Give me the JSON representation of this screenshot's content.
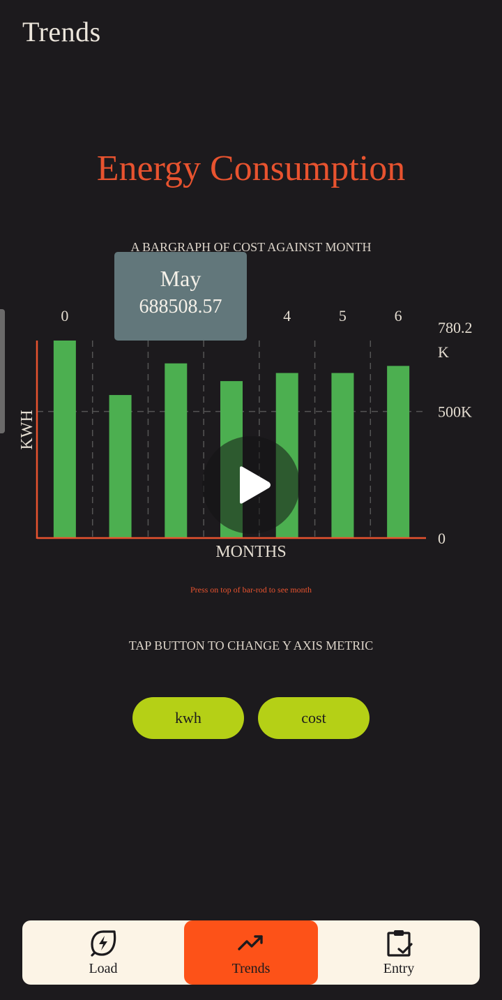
{
  "app": {
    "title": "Trends"
  },
  "chart": {
    "title": "Energy Consumption",
    "subtitle": "A BARGRAPH OF COST AGAINST MONTH",
    "hint": "Press on top of bar-rod to see month",
    "tooltip": {
      "month": "May",
      "value": "688508.57"
    }
  },
  "chart_data": {
    "type": "bar",
    "categories": [
      "0",
      "1",
      "2",
      "3",
      "4",
      "5",
      "6"
    ],
    "values": [
      780200,
      565000,
      690000,
      620000,
      652000,
      652000,
      680000
    ],
    "xlabel": "MONTHS",
    "ylabel": "KWH",
    "ylim": [
      0,
      780200
    ],
    "y_ticks": [
      {
        "value": 0,
        "label": "0"
      },
      {
        "value": 500000,
        "label": "500K"
      },
      {
        "value": 780200,
        "label": "780.2 K"
      }
    ],
    "hidden_x_ticks": [
      "1",
      "2",
      "3"
    ],
    "grid": true,
    "colors": {
      "bar": "#4caf50",
      "axis": "#e8532f",
      "grid": "#555555"
    }
  },
  "metric": {
    "label": "TAP BUTTON TO CHANGE Y AXIS METRIC",
    "buttons": [
      {
        "label": "kwh"
      },
      {
        "label": "cost"
      }
    ]
  },
  "nav": {
    "items": [
      {
        "label": "Load",
        "icon": "bolt-leaf-icon"
      },
      {
        "label": "Trends",
        "icon": "trending-up-icon",
        "active": true
      },
      {
        "label": "Entry",
        "icon": "clipboard-check-icon"
      }
    ]
  },
  "colors": {
    "background": "#1c1a1d",
    "accent": "#e8532f",
    "active_nav": "#fd5218",
    "button": "#b5d016",
    "nav_bg": "#fcf4e6"
  }
}
